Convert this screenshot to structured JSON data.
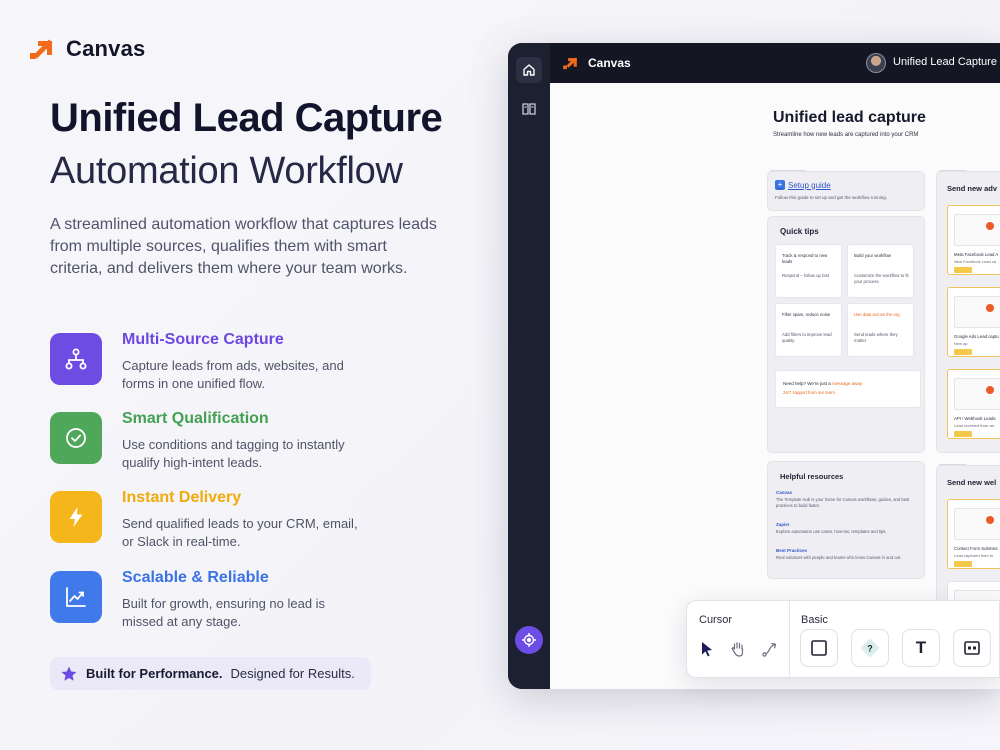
{
  "brand": {
    "name": "Canvas",
    "accent": "#f26b1d"
  },
  "hero": {
    "title": "Unified Lead Capture",
    "subtitle": "Automation Workflow",
    "description": "A streamlined automation workflow that captures leads from multiple sources, qualifies them with smart criteria, and delivers them where your team works."
  },
  "features": [
    {
      "title": "Multi-Source Capture",
      "description": "Capture leads from ads, websites, and forms in one unified flow.",
      "icon": "network-icon",
      "color": "#6d4ce3"
    },
    {
      "title": "Smart Qualification",
      "description": "Use conditions and tagging to instantly qualify high-intent leads.",
      "icon": "check-circle-icon",
      "color": "#4fa85a"
    },
    {
      "title": "Instant Delivery",
      "description": "Send qualified leads to your CRM, email, or Slack in real-time.",
      "icon": "lightning-icon",
      "color": "#f5b61c"
    },
    {
      "title": "Scalable & Reliable",
      "description": "Built for growth, ensuring no lead is missed at any stage.",
      "icon": "trend-up-icon",
      "color": "#3f79ea"
    }
  ],
  "performance": {
    "bold": "Built for Performance.",
    "rest": "Designed for Results."
  },
  "app": {
    "name": "Canvas",
    "window_title": "Unified Lead Capture [T",
    "canvas": {
      "title": "Unified lead capture",
      "subtitle": "Streamline how new leads are captured into your CRM",
      "start_tag": "START HERE",
      "setup_label": "Setup guide",
      "setup_desc": "Follow this guide to set up and get the workflow running.",
      "quick_tips": {
        "title": "Quick tips",
        "tips": [
          {
            "a": "Track & respond to new leads",
            "b": "Respond – follow up fast"
          },
          {
            "a": "Build your workflow",
            "b": "Customize the workflow to fit your process"
          },
          {
            "a": "Filter spam, reduce noise",
            "b": "Add filters to improve lead quality"
          },
          {
            "a": "Use data across the org",
            "b": "Send leads where they matter"
          }
        ],
        "help_prefix": "Need help? We're just a",
        "help_link": "message away",
        "help_line2": "24/7 support from our team"
      },
      "resources": {
        "title": "Helpful resources",
        "items": [
          {
            "title": "Canvas",
            "desc": "The Template Hub is your home for Canvas workflows, guides, and best practices to build faster."
          },
          {
            "title": "Zapier",
            "desc": "Explore automation use cases, how-tos, templates and tips."
          },
          {
            "title": "Best Practices",
            "desc": "Real solutions with people and teams who know Canvas in and out."
          }
        ]
      },
      "trigger_tag": "TRIGGER",
      "trigger1": {
        "title": "Send new adv",
        "cards": [
          {
            "label": "Meta Facebook Lead A",
            "sub": "New Facebook Lead ca"
          },
          {
            "label": "Google Ads Lead captu",
            "sub": "New ap"
          },
          {
            "label": "API / Webhook Leads",
            "sub": "Lead received from we"
          }
        ]
      },
      "trigger2": {
        "title": "Send new wel",
        "cards": [
          {
            "label": "Contact Form Submiss",
            "sub": "Lead captured from fo"
          }
        ]
      }
    },
    "toolbar": {
      "cursor_label": "Cursor",
      "basic_label": "Basic",
      "text_tool_glyph": "T",
      "question_glyph": "?"
    }
  }
}
